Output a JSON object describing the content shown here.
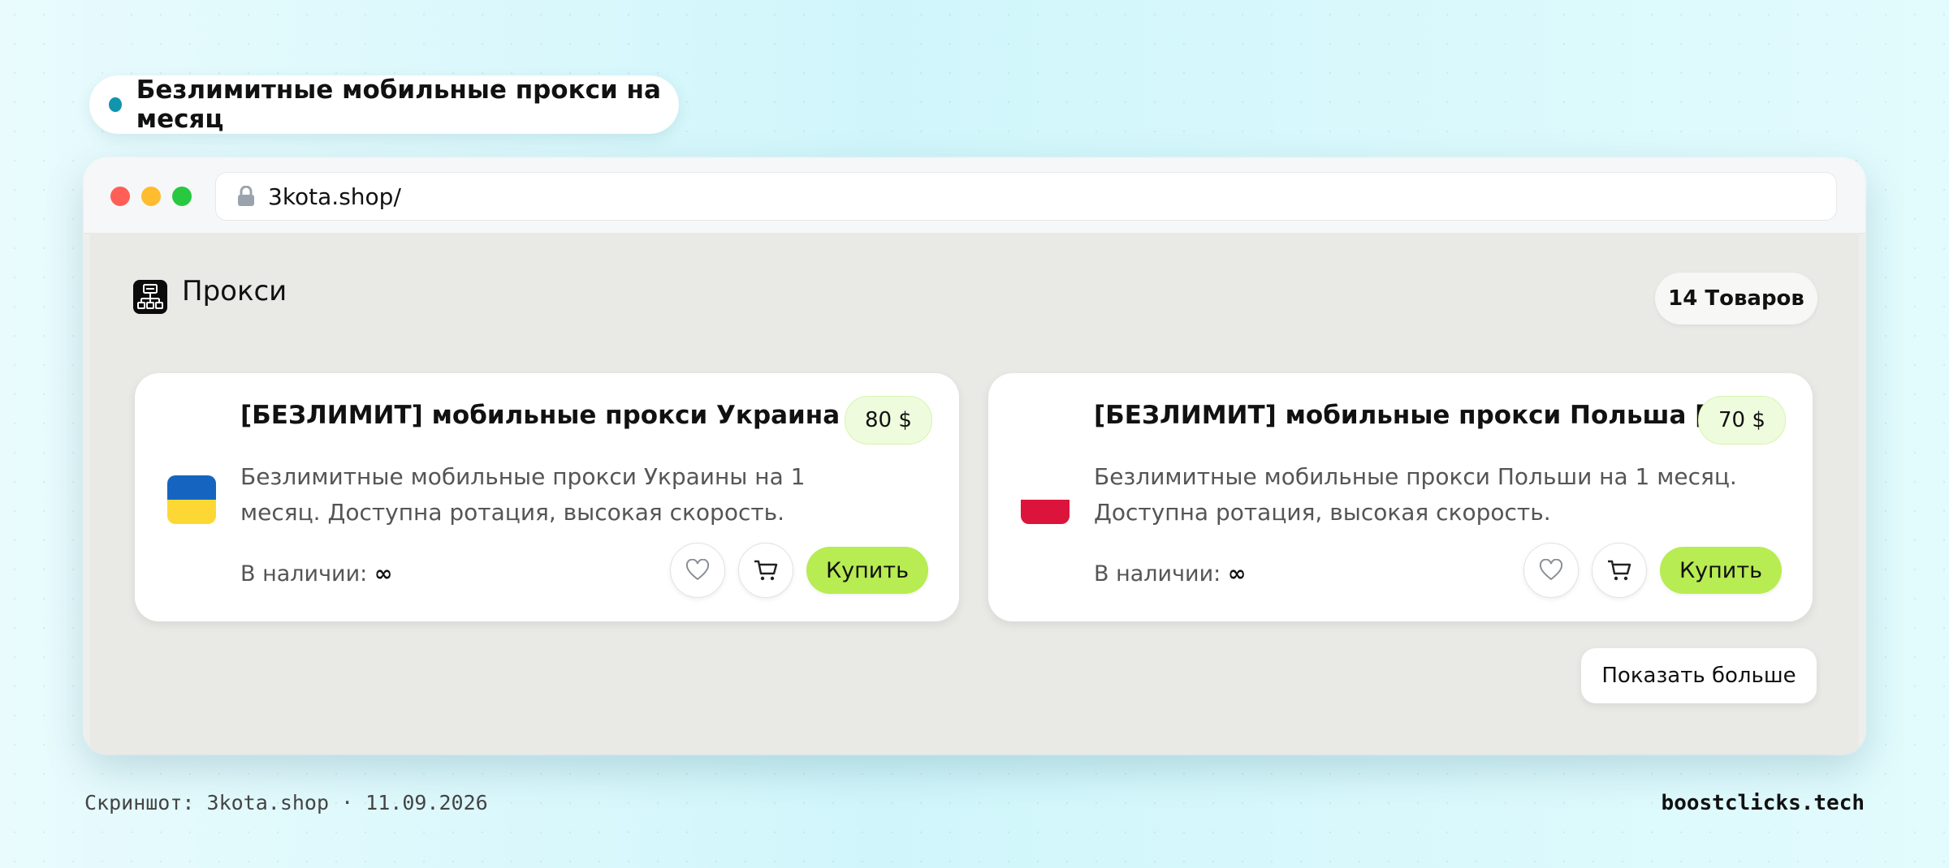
{
  "headline": {
    "text": "Безлимитные мобильные прокси на месяц"
  },
  "browser": {
    "url": "3kota.shop/"
  },
  "category": {
    "title": "Прокси",
    "count_label": "14 Товаров"
  },
  "products": [
    {
      "title": "[БЕЗЛИМИТ] мобильные прокси Украина [UA]",
      "price": "80 $",
      "description": "Безлимитные мобильные прокси Украины на 1 месяц. Доступна ротация, высокая скорость.",
      "stock_label": "В наличии:",
      "stock_value": "∞",
      "buy_label": "Купить",
      "flag": {
        "icon": "ukraine-flag-icon",
        "top": "#1565c0",
        "bottom": "#fdd835"
      }
    },
    {
      "title": "[БЕЗЛИМИТ] мобильные прокси Польша [PL]",
      "price": "70 $",
      "description": "Безлимитные мобильные прокси Польши на 1 месяц. Доступна ротация, высокая скорость.",
      "stock_label": "В наличии:",
      "stock_value": "∞",
      "buy_label": "Купить",
      "flag": {
        "icon": "poland-flag-icon",
        "top": "#ffffff",
        "bottom": "#dc143c"
      }
    }
  ],
  "show_more_label": "Показать больше",
  "footer": {
    "caption": "Скриншот: 3kota.shop · 11.09.2026",
    "brand": "boostclicks.tech"
  },
  "colors": {
    "accent_dot": "#1194ad",
    "buy_button": "#b7ec52",
    "price_badge_bg": "#eefbdc"
  }
}
